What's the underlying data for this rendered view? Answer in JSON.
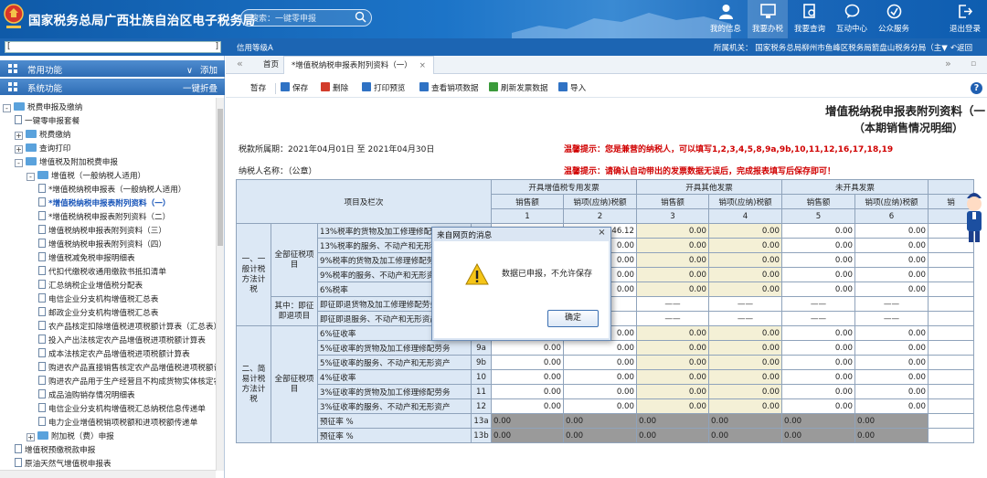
{
  "header": {
    "title": "国家税务总局广西壮族自治区电子税务局",
    "search_placeholder": "搜索：一键零申报",
    "nav": [
      {
        "label": "我的信息",
        "icon": "user-icon"
      },
      {
        "label": "我要办税",
        "icon": "monitor-icon"
      },
      {
        "label": "我要查询",
        "icon": "query-icon"
      },
      {
        "label": "互动中心",
        "icon": "chat-icon"
      },
      {
        "label": "公众服务",
        "icon": "service-icon"
      },
      {
        "label": "退出登录",
        "icon": "logout-icon"
      }
    ]
  },
  "subbar": {
    "level": "信用等级A",
    "office": "所属机关：  国家税务总局柳州市鱼峰区税务局箭盘山税务分局（主▼",
    "back": "返回"
  },
  "left": {
    "common_header": "常用功能",
    "common_action": "添加",
    "system_header": "系统功能",
    "system_action": "一键折叠",
    "tree": [
      {
        "label": "税费申报及缴纳",
        "indent": 0,
        "kind": "folder",
        "toggle": "-"
      },
      {
        "label": "一键零申报套餐",
        "indent": 1,
        "kind": "doc",
        "toggle": ""
      },
      {
        "label": "税费缴纳",
        "indent": 1,
        "kind": "folder",
        "toggle": "+"
      },
      {
        "label": "查询打印",
        "indent": 1,
        "kind": "folder",
        "toggle": "+"
      },
      {
        "label": "增值税及附加税费申报",
        "indent": 1,
        "kind": "folder",
        "toggle": "-"
      },
      {
        "label": "增值税（一般纳税人适用）",
        "indent": 2,
        "kind": "folder",
        "toggle": "-"
      },
      {
        "label": "*增值税纳税申报表（一般纳税人适用）",
        "indent": 3,
        "kind": "doc",
        "toggle": ""
      },
      {
        "label": "*增值税纳税申报表附列资料（一）",
        "indent": 3,
        "kind": "doc",
        "toggle": "",
        "selected": true
      },
      {
        "label": "*增值税纳税申报表附列资料（二）",
        "indent": 3,
        "kind": "doc",
        "toggle": ""
      },
      {
        "label": "增值税纳税申报表附列资料（三）",
        "indent": 3,
        "kind": "doc",
        "toggle": ""
      },
      {
        "label": "增值税纳税申报表附列资料（四）",
        "indent": 3,
        "kind": "doc",
        "toggle": ""
      },
      {
        "label": "增值税减免税申报明细表",
        "indent": 3,
        "kind": "doc",
        "toggle": ""
      },
      {
        "label": "代扣代缴税收通用缴款书抵扣清单",
        "indent": 3,
        "kind": "doc",
        "toggle": ""
      },
      {
        "label": "汇总纳税企业增值税分配表",
        "indent": 3,
        "kind": "doc",
        "toggle": ""
      },
      {
        "label": "电信企业分支机构增值税汇总表",
        "indent": 3,
        "kind": "doc",
        "toggle": ""
      },
      {
        "label": "邮政企业分支机构增值税汇总表",
        "indent": 3,
        "kind": "doc",
        "toggle": ""
      },
      {
        "label": "农产品核定扣除增值税进项税额计算表（汇总表）",
        "indent": 3,
        "kind": "doc",
        "toggle": ""
      },
      {
        "label": "投入产出法核定农产品增值税进项税额计算表",
        "indent": 3,
        "kind": "doc",
        "toggle": ""
      },
      {
        "label": "成本法核定农产品增值税进项税额计算表",
        "indent": 3,
        "kind": "doc",
        "toggle": ""
      },
      {
        "label": "购进农产品直接销售核定农产品增值税进项税额计算",
        "indent": 3,
        "kind": "doc",
        "toggle": ""
      },
      {
        "label": "购进农产品用于生产经营且不构成货物实体核定农产",
        "indent": 3,
        "kind": "doc",
        "toggle": ""
      },
      {
        "label": "成品油购销存情况明细表",
        "indent": 3,
        "kind": "doc",
        "toggle": ""
      },
      {
        "label": "电信企业分支机构增值税汇总纳税信息传递单",
        "indent": 3,
        "kind": "doc",
        "toggle": ""
      },
      {
        "label": "电力企业增值税销项税额和进项税额传递单",
        "indent": 3,
        "kind": "doc",
        "toggle": ""
      },
      {
        "label": "附加税（费）申报",
        "indent": 2,
        "kind": "folder",
        "toggle": "+"
      },
      {
        "label": "增值税预缴税款申报",
        "indent": 1,
        "kind": "doc",
        "toggle": ""
      },
      {
        "label": "原油天然气增值税申报表",
        "indent": 1,
        "kind": "doc",
        "toggle": ""
      }
    ]
  },
  "tabs": {
    "home": "首页",
    "current": "*增值税纳税申报表附列资料（一）"
  },
  "toolbar": {
    "items": [
      {
        "label": "暂存",
        "color": ""
      },
      {
        "label": "保存",
        "color": "#2f72c4"
      },
      {
        "label": "删除",
        "color": "#d23c2b"
      },
      {
        "label": "打印预览",
        "color": "#2f72c4"
      },
      {
        "label": "查看销项数据",
        "color": "#2f72c4"
      },
      {
        "label": "刷新发票数据",
        "color": "#3b9a3b"
      },
      {
        "label": "导入",
        "color": "#2f72c4"
      }
    ]
  },
  "form": {
    "title1": "增值税纳税申报表附列资料（一",
    "title2": "（本期销售情况明细）",
    "period": "税款所属期：2021年04月01日 至 2021年04月30日",
    "taxpayer": "纳税人名称：（公章）",
    "tip1": "温馨提示：您是兼营的纳税人，可以填写1,2,3,4,5,8,9a,9b,10,11,12,16,17,18,19",
    "tip2": "温馨提示：请确认自动带出的发票数据无误后，完成报表填写后保存即可！",
    "header": {
      "item_col": "项目及栏次",
      "groups": [
        "开具增值税专用发票",
        "开具其他发票",
        "未开具发票",
        ""
      ],
      "sub": [
        "销售额",
        "销项(应纳)税额",
        "销售额",
        "销项(应纳)税额",
        "销售额",
        "销项(应纳)税额",
        "销"
      ],
      "nums": [
        "1",
        "2",
        "3",
        "4",
        "5",
        "6",
        ""
      ]
    },
    "section1": {
      "label": "一、一般计税方法计税",
      "all_label": "全部征税项目",
      "imm_label": "其中：即征即退项目"
    },
    "section2": {
      "label": "二、简易计税方法计税",
      "all_label": "全部征税项目"
    },
    "rows1": [
      {
        "name": "13%税率的货物及加工修理修配劳务",
        "no": "1",
        "v": [
          "",
          "46.12",
          "0.00",
          "0.00",
          "0.00",
          "0.00",
          ""
        ]
      },
      {
        "name": "13%税率的服务、不动产和无形资产",
        "no": "2",
        "v": [
          "",
          "0.00",
          "0.00",
          "0.00",
          "0.00",
          "0.00",
          ""
        ]
      },
      {
        "name": "9%税率的货物及加工修理修配劳务",
        "no": "3",
        "v": [
          "",
          "0.00",
          "0.00",
          "0.00",
          "0.00",
          "0.00",
          ""
        ]
      },
      {
        "name": "9%税率的服务、不动产和无形资产",
        "no": "4",
        "v": [
          "",
          "0.00",
          "0.00",
          "0.00",
          "0.00",
          "0.00",
          ""
        ]
      },
      {
        "name": "6%税率",
        "no": "5",
        "v": [
          "",
          "0.00",
          "0.00",
          "0.00",
          "0.00",
          "0.00",
          ""
        ]
      }
    ],
    "rows_imm": [
      {
        "name": "即征即退货物及加工修理修配劳务",
        "no": "6",
        "v": [
          "——",
          "——",
          "——",
          "——",
          "——",
          "——",
          ""
        ]
      },
      {
        "name": "即征即退服务、不动产和无形资产",
        "no": "7",
        "v": [
          "——",
          "——",
          "——",
          "——",
          "——",
          "——",
          ""
        ]
      }
    ],
    "rows2": [
      {
        "name": "6%征收率",
        "no": "8",
        "v": [
          "0.00",
          "0.00",
          "0.00",
          "0.00",
          "0.00",
          "0.00",
          ""
        ]
      },
      {
        "name": "5%征收率的货物及加工修理修配劳务",
        "no": "9a",
        "v": [
          "0.00",
          "0.00",
          "0.00",
          "0.00",
          "0.00",
          "0.00",
          ""
        ]
      },
      {
        "name": "5%征收率的服务、不动产和无形资产",
        "no": "9b",
        "v": [
          "0.00",
          "0.00",
          "0.00",
          "0.00",
          "0.00",
          "0.00",
          ""
        ]
      },
      {
        "name": "4%征收率",
        "no": "10",
        "v": [
          "0.00",
          "0.00",
          "0.00",
          "0.00",
          "0.00",
          "0.00",
          ""
        ]
      },
      {
        "name": "3%征收率的货物及加工修理修配劳务",
        "no": "11",
        "v": [
          "0.00",
          "0.00",
          "0.00",
          "0.00",
          "0.00",
          "0.00",
          ""
        ]
      },
      {
        "name": "3%征收率的服务、不动产和无形资产",
        "no": "12",
        "v": [
          "0.00",
          "0.00",
          "0.00",
          "0.00",
          "0.00",
          "0.00",
          ""
        ]
      },
      {
        "name": "预征率  %",
        "no": "13a",
        "v": [
          "0.00",
          "0.00",
          "0.00",
          "0.00",
          "0.00",
          "0.00",
          ""
        ]
      },
      {
        "name": "预征率  %",
        "no": "13b",
        "v": [
          "0.00",
          "0.00",
          "0.00",
          "0.00",
          "0.00",
          "0.00",
          ""
        ]
      }
    ]
  },
  "dialog": {
    "title": "来自网页的消息",
    "message": "数据已申报，不允许保存",
    "ok": "确定"
  }
}
